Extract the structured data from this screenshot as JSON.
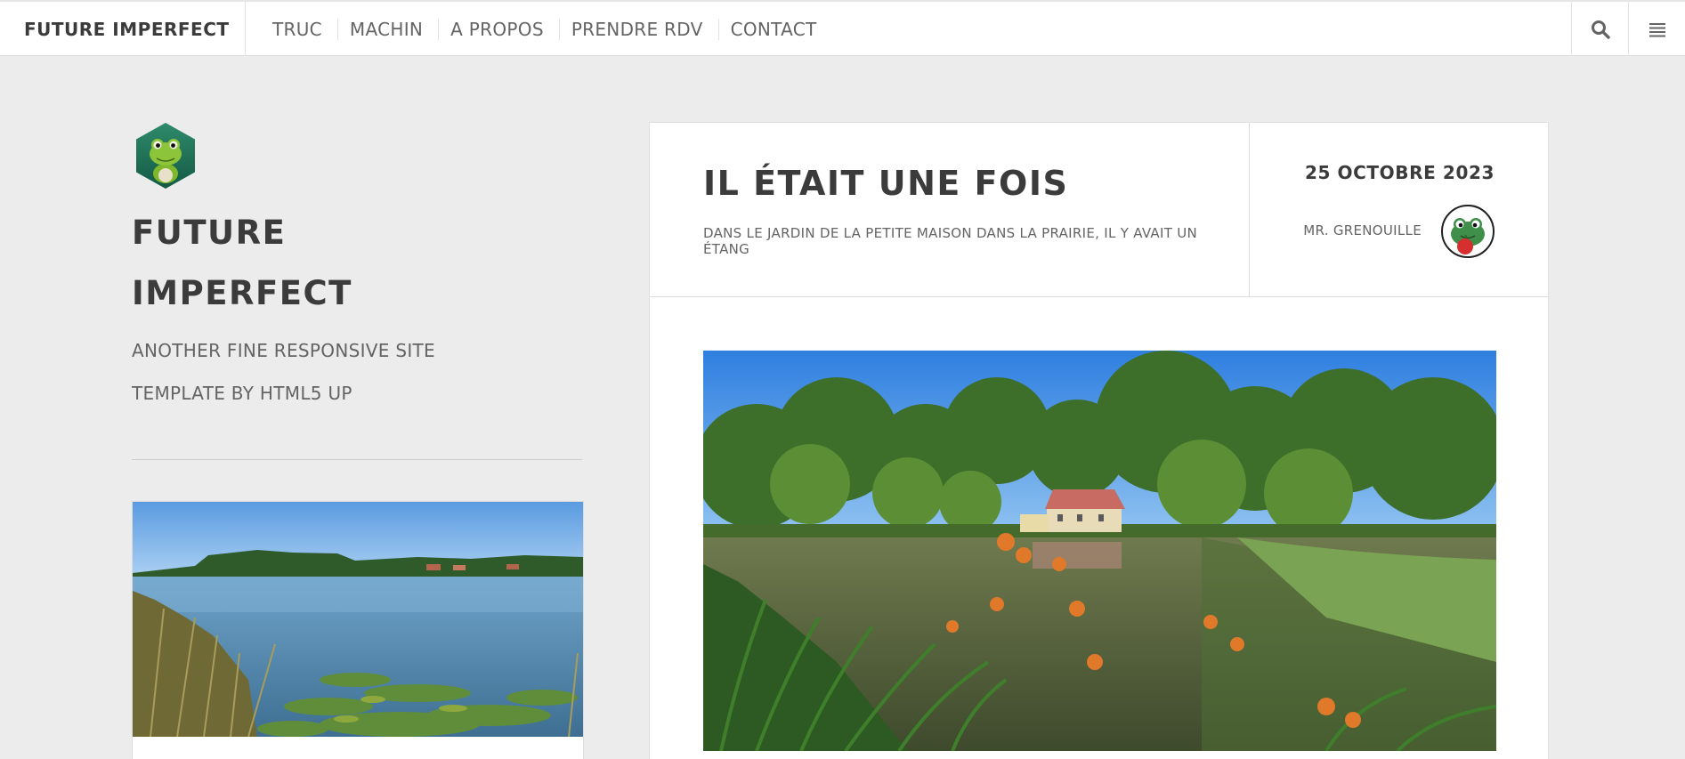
{
  "header": {
    "site_title": "FUTURE IMPERFECT",
    "nav": [
      "TRUC",
      "MACHIN",
      "A PROPOS",
      "PRENDRE RDV",
      "CONTACT"
    ],
    "icons": {
      "search": "search-icon",
      "menu": "menu-icon"
    }
  },
  "intro": {
    "logo": "frog-logo",
    "title_line1": "FUTURE",
    "title_line2": "IMPERFECT",
    "subtitle_line1": "ANOTHER FINE RESPONSIVE SITE",
    "subtitle_line2": "TEMPLATE BY HTML5 UP"
  },
  "post": {
    "title": "IL ÉTAIT UNE FOIS",
    "subtitle": "DANS LE JARDIN DE LA PETITE MAISON DANS LA PRAIRIE, IL Y AVAIT UN ÉTANG",
    "date": "25 OCTOBRE 2023",
    "author": "MR. GRENOUILLE"
  },
  "colors": {
    "background": "#ececec",
    "panel": "#ffffff",
    "text": "#3c3b3b",
    "muted": "#646464"
  }
}
